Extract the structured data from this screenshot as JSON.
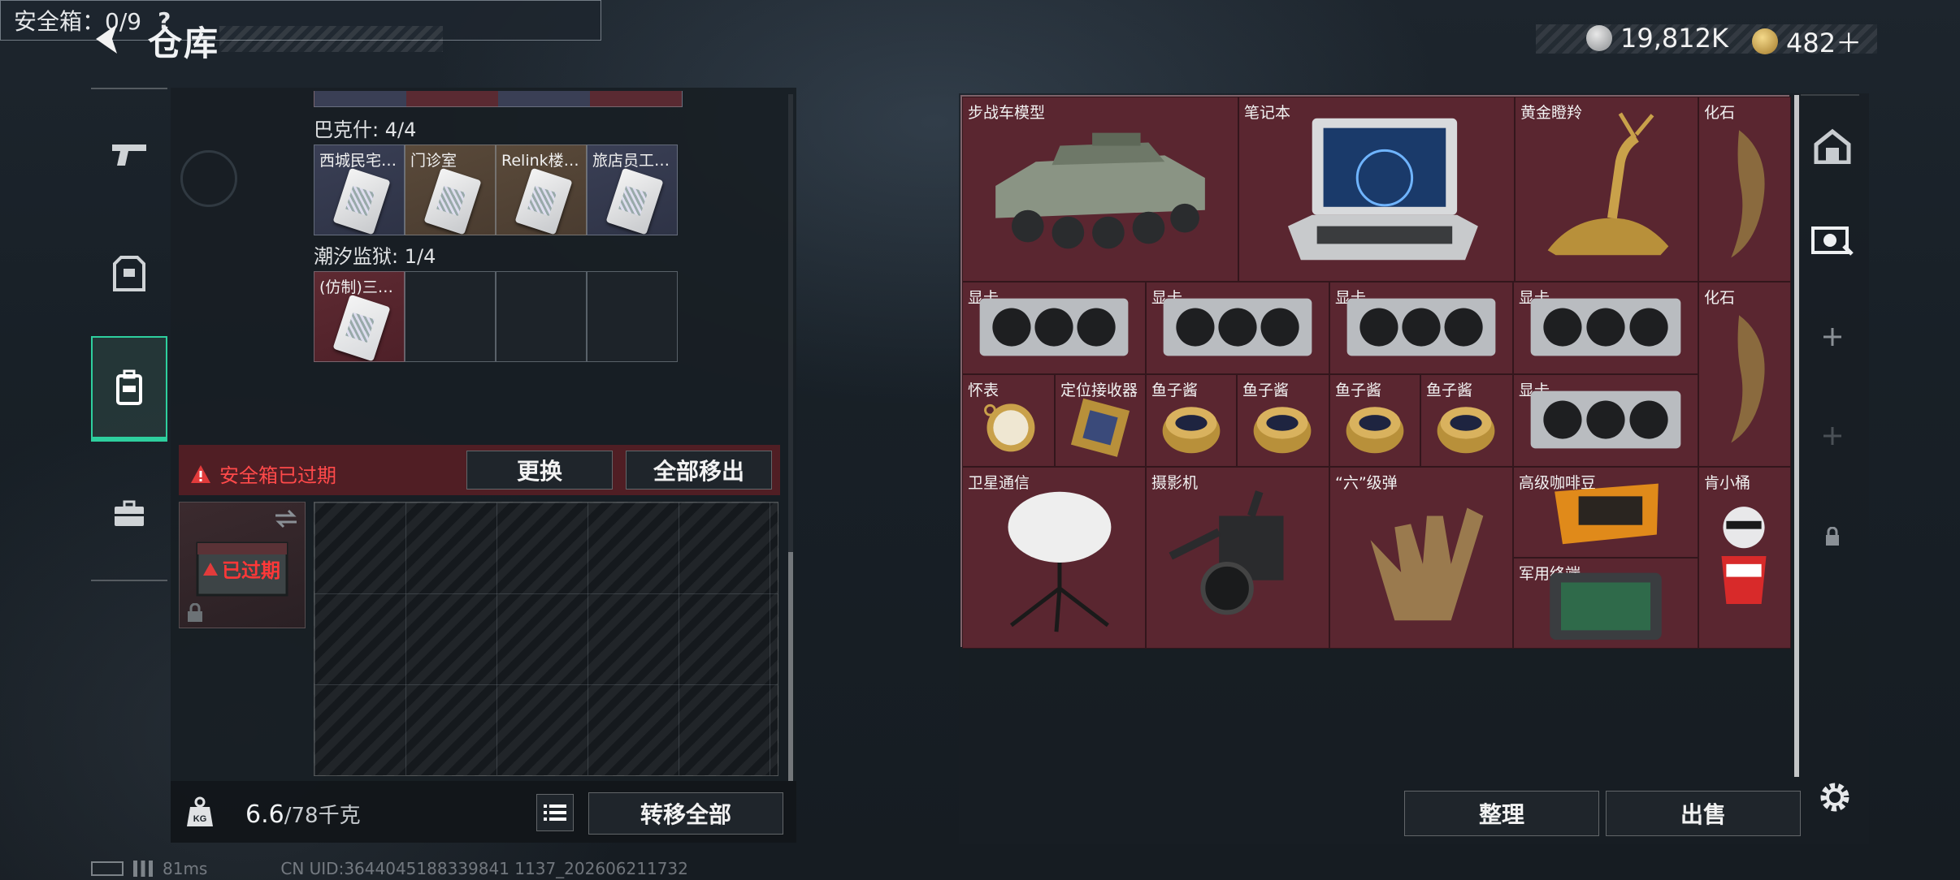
{
  "header": {
    "title": "仓库",
    "currency_1": "19,812K",
    "currency_2": "482＋",
    "colors": {
      "accent": "#2ecf9e",
      "danger": "#e23b3b",
      "stash_bg": "#4e1f26"
    }
  },
  "left_nav": {
    "items": [
      {
        "icon": "pistol-icon"
      },
      {
        "icon": "armor-vest-icon"
      },
      {
        "icon": "backpack-icon",
        "active": true
      },
      {
        "icon": "briefcase-icon"
      }
    ]
  },
  "container": {
    "group1": {
      "label": "巴克什: 4/4",
      "slots": [
        "西城民宅…",
        "门诊室",
        "Relink楼…",
        "旅店员工…"
      ]
    },
    "group2": {
      "label": "潮汐监狱: 1/4",
      "slots": [
        "(仿制)三…"
      ]
    },
    "safe_box": {
      "label": "安全箱：0/9",
      "help": "?"
    },
    "expired_warning": "安全箱已过期",
    "replace_btn": "更换",
    "move_all_out_btn": "全部移出",
    "expired_badge": "已过期",
    "weight_current": "6.6",
    "weight_total": "/78千克",
    "transfer_all_btn": "转移全部"
  },
  "stash": {
    "items": [
      {
        "name": "步战车模型"
      },
      {
        "name": "笔记本"
      },
      {
        "name": "黄金瞪羚"
      },
      {
        "name": "化石"
      },
      {
        "name": "显卡"
      },
      {
        "name": "显卡"
      },
      {
        "name": "显卡"
      },
      {
        "name": "显卡"
      },
      {
        "name": "化石"
      },
      {
        "name": "怀表"
      },
      {
        "name": "定位接收器"
      },
      {
        "name": "鱼子酱"
      },
      {
        "name": "鱼子酱"
      },
      {
        "name": "鱼子酱"
      },
      {
        "name": "鱼子酱"
      },
      {
        "name": "显卡"
      },
      {
        "name": "卫星通信"
      },
      {
        "name": "摄影机"
      },
      {
        "name": "“六”级弹"
      },
      {
        "name": "高级咖啡豆"
      },
      {
        "name": "军用终端"
      },
      {
        "name": "肯小桶"
      }
    ],
    "sort_btn": "整理",
    "sell_btn": "出售"
  },
  "status": {
    "latency": "81ms",
    "uid": "CN UID:3644045188339841 1137_202606211732"
  }
}
